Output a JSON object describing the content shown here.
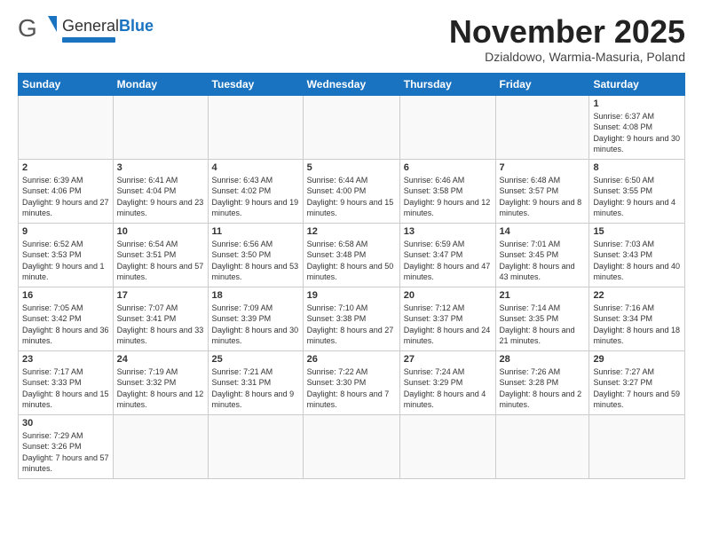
{
  "header": {
    "logo_general": "General",
    "logo_blue": "Blue",
    "month_title": "November 2025",
    "location": "Dzialdowo, Warmia-Masuria, Poland"
  },
  "weekdays": [
    "Sunday",
    "Monday",
    "Tuesday",
    "Wednesday",
    "Thursday",
    "Friday",
    "Saturday"
  ],
  "weeks": [
    [
      {
        "day": "",
        "info": ""
      },
      {
        "day": "",
        "info": ""
      },
      {
        "day": "",
        "info": ""
      },
      {
        "day": "",
        "info": ""
      },
      {
        "day": "",
        "info": ""
      },
      {
        "day": "",
        "info": ""
      },
      {
        "day": "1",
        "info": "Sunrise: 6:37 AM\nSunset: 4:08 PM\nDaylight: 9 hours and 30 minutes."
      }
    ],
    [
      {
        "day": "2",
        "info": "Sunrise: 6:39 AM\nSunset: 4:06 PM\nDaylight: 9 hours and 27 minutes."
      },
      {
        "day": "3",
        "info": "Sunrise: 6:41 AM\nSunset: 4:04 PM\nDaylight: 9 hours and 23 minutes."
      },
      {
        "day": "4",
        "info": "Sunrise: 6:43 AM\nSunset: 4:02 PM\nDaylight: 9 hours and 19 minutes."
      },
      {
        "day": "5",
        "info": "Sunrise: 6:44 AM\nSunset: 4:00 PM\nDaylight: 9 hours and 15 minutes."
      },
      {
        "day": "6",
        "info": "Sunrise: 6:46 AM\nSunset: 3:58 PM\nDaylight: 9 hours and 12 minutes."
      },
      {
        "day": "7",
        "info": "Sunrise: 6:48 AM\nSunset: 3:57 PM\nDaylight: 9 hours and 8 minutes."
      },
      {
        "day": "8",
        "info": "Sunrise: 6:50 AM\nSunset: 3:55 PM\nDaylight: 9 hours and 4 minutes."
      }
    ],
    [
      {
        "day": "9",
        "info": "Sunrise: 6:52 AM\nSunset: 3:53 PM\nDaylight: 9 hours and 1 minute."
      },
      {
        "day": "10",
        "info": "Sunrise: 6:54 AM\nSunset: 3:51 PM\nDaylight: 8 hours and 57 minutes."
      },
      {
        "day": "11",
        "info": "Sunrise: 6:56 AM\nSunset: 3:50 PM\nDaylight: 8 hours and 53 minutes."
      },
      {
        "day": "12",
        "info": "Sunrise: 6:58 AM\nSunset: 3:48 PM\nDaylight: 8 hours and 50 minutes."
      },
      {
        "day": "13",
        "info": "Sunrise: 6:59 AM\nSunset: 3:47 PM\nDaylight: 8 hours and 47 minutes."
      },
      {
        "day": "14",
        "info": "Sunrise: 7:01 AM\nSunset: 3:45 PM\nDaylight: 8 hours and 43 minutes."
      },
      {
        "day": "15",
        "info": "Sunrise: 7:03 AM\nSunset: 3:43 PM\nDaylight: 8 hours and 40 minutes."
      }
    ],
    [
      {
        "day": "16",
        "info": "Sunrise: 7:05 AM\nSunset: 3:42 PM\nDaylight: 8 hours and 36 minutes."
      },
      {
        "day": "17",
        "info": "Sunrise: 7:07 AM\nSunset: 3:41 PM\nDaylight: 8 hours and 33 minutes."
      },
      {
        "day": "18",
        "info": "Sunrise: 7:09 AM\nSunset: 3:39 PM\nDaylight: 8 hours and 30 minutes."
      },
      {
        "day": "19",
        "info": "Sunrise: 7:10 AM\nSunset: 3:38 PM\nDaylight: 8 hours and 27 minutes."
      },
      {
        "day": "20",
        "info": "Sunrise: 7:12 AM\nSunset: 3:37 PM\nDaylight: 8 hours and 24 minutes."
      },
      {
        "day": "21",
        "info": "Sunrise: 7:14 AM\nSunset: 3:35 PM\nDaylight: 8 hours and 21 minutes."
      },
      {
        "day": "22",
        "info": "Sunrise: 7:16 AM\nSunset: 3:34 PM\nDaylight: 8 hours and 18 minutes."
      }
    ],
    [
      {
        "day": "23",
        "info": "Sunrise: 7:17 AM\nSunset: 3:33 PM\nDaylight: 8 hours and 15 minutes."
      },
      {
        "day": "24",
        "info": "Sunrise: 7:19 AM\nSunset: 3:32 PM\nDaylight: 8 hours and 12 minutes."
      },
      {
        "day": "25",
        "info": "Sunrise: 7:21 AM\nSunset: 3:31 PM\nDaylight: 8 hours and 9 minutes."
      },
      {
        "day": "26",
        "info": "Sunrise: 7:22 AM\nSunset: 3:30 PM\nDaylight: 8 hours and 7 minutes."
      },
      {
        "day": "27",
        "info": "Sunrise: 7:24 AM\nSunset: 3:29 PM\nDaylight: 8 hours and 4 minutes."
      },
      {
        "day": "28",
        "info": "Sunrise: 7:26 AM\nSunset: 3:28 PM\nDaylight: 8 hours and 2 minutes."
      },
      {
        "day": "29",
        "info": "Sunrise: 7:27 AM\nSunset: 3:27 PM\nDaylight: 7 hours and 59 minutes."
      }
    ],
    [
      {
        "day": "30",
        "info": "Sunrise: 7:29 AM\nSunset: 3:26 PM\nDaylight: 7 hours and 57 minutes."
      },
      {
        "day": "",
        "info": ""
      },
      {
        "day": "",
        "info": ""
      },
      {
        "day": "",
        "info": ""
      },
      {
        "day": "",
        "info": ""
      },
      {
        "day": "",
        "info": ""
      },
      {
        "day": "",
        "info": ""
      }
    ]
  ]
}
